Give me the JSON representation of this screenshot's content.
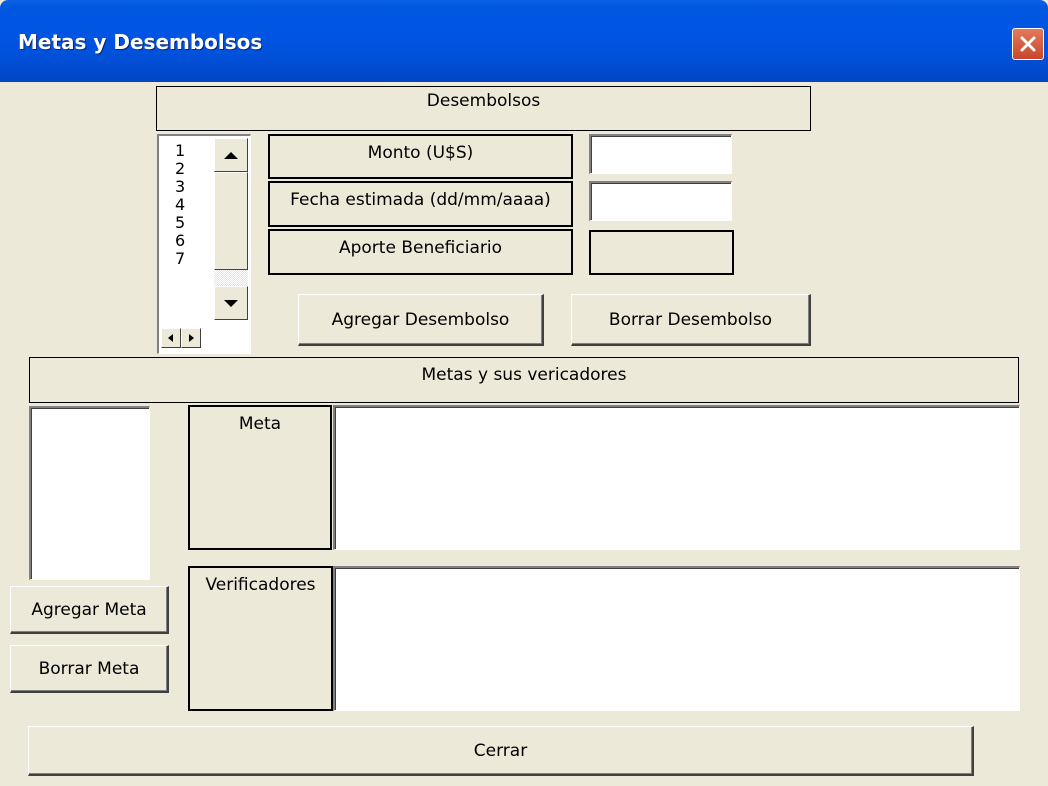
{
  "window": {
    "title": "Metas y Desembolsos"
  },
  "desembolsos": {
    "header": "Desembolsos",
    "list_items": [
      "1",
      "2",
      "3",
      "4",
      "5",
      "6",
      "7"
    ],
    "monto_label": "Monto (U$S)",
    "monto_value": "",
    "fecha_label": "Fecha estimada (dd/mm/aaaa)",
    "fecha_value": "",
    "aporte_label": "Aporte Beneficiario",
    "aporte_value": "",
    "add_button": "Agregar Desembolso",
    "delete_button": "Borrar Desembolso"
  },
  "metas": {
    "header": "Metas y sus vericadores",
    "meta_label": "Meta",
    "meta_value": "",
    "verificadores_label": "Verificadores",
    "verificadores_value": "",
    "add_button": "Agregar Meta",
    "delete_button": "Borrar Meta"
  },
  "footer": {
    "close_button": "Cerrar"
  },
  "icons": {
    "close": "close-icon",
    "scroll_up": "arrow-up-icon",
    "scroll_down": "arrow-down-icon",
    "scroll_left": "arrow-left-icon",
    "scroll_right": "arrow-right-icon"
  },
  "colors": {
    "titlebar": "#0054e3",
    "dialog_bg": "#ece9d8",
    "close_button": "#c8462c"
  }
}
